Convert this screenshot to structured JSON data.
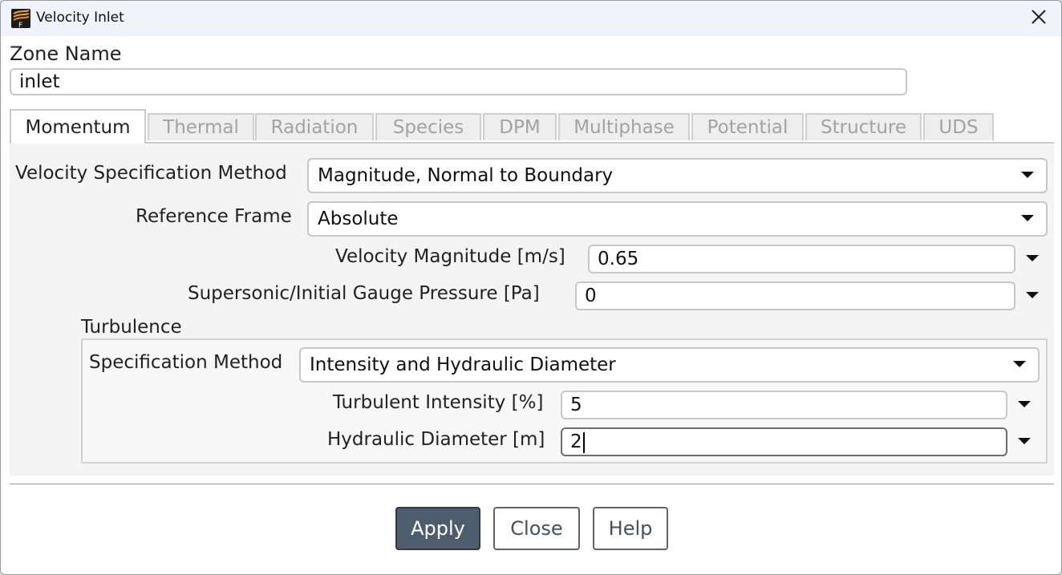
{
  "window": {
    "title": "Velocity Inlet"
  },
  "zone": {
    "label": "Zone Name",
    "value": "inlet"
  },
  "tabs": [
    {
      "label": "Momentum",
      "active": true
    },
    {
      "label": "Thermal",
      "active": false
    },
    {
      "label": "Radiation",
      "active": false
    },
    {
      "label": "Species",
      "active": false
    },
    {
      "label": "DPM",
      "active": false
    },
    {
      "label": "Multiphase",
      "active": false
    },
    {
      "label": "Potential",
      "active": false
    },
    {
      "label": "Structure",
      "active": false
    },
    {
      "label": "UDS",
      "active": false
    }
  ],
  "momentum": {
    "velocity_spec_method": {
      "label": "Velocity Specification Method",
      "value": "Magnitude, Normal to Boundary"
    },
    "reference_frame": {
      "label": "Reference Frame",
      "value": "Absolute"
    },
    "velocity_magnitude": {
      "label": "Velocity Magnitude [m/s]",
      "value": "0.65"
    },
    "gauge_pressure": {
      "label": "Supersonic/Initial Gauge Pressure [Pa]",
      "value": "0"
    }
  },
  "turbulence": {
    "heading": "Turbulence",
    "spec_method": {
      "label": "Specification Method",
      "value": "Intensity and Hydraulic Diameter"
    },
    "intensity": {
      "label": "Turbulent Intensity [%]",
      "value": "5"
    },
    "hydraulic_diameter": {
      "label": "Hydraulic Diameter [m]",
      "value": "2"
    }
  },
  "buttons": {
    "apply": "Apply",
    "close": "Close",
    "help": "Help"
  },
  "icons": {
    "app": "fluent-app-icon",
    "close": "close-icon",
    "dropdown": "dropdown-arrow-icon"
  },
  "colors": {
    "primary_button": "#4e5d6d",
    "titlebar": "#f0f3f9",
    "panel": "#f4f4f4"
  }
}
